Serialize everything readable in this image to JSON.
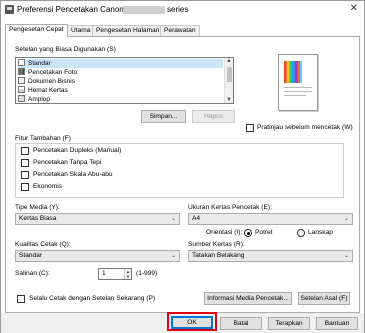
{
  "window": {
    "title_prefix": "Preferensi Pencetakan Canon",
    "title_suffix": "series",
    "close_glyph": "✕"
  },
  "tabs": [
    {
      "label": "Pengesetan Cepat",
      "active": true
    },
    {
      "label": "Utama"
    },
    {
      "label": "Pengesetan Halaman"
    },
    {
      "label": "Perawatan"
    }
  ],
  "common_settings": {
    "label": "Setelan yang Biasa Digunakan (S)",
    "items": [
      {
        "label": "Standar",
        "icon": "standard-icon"
      },
      {
        "label": "Pencetakan Foto",
        "icon": "photo-icon"
      },
      {
        "label": "Dokumen Bisnis",
        "icon": "document-icon"
      },
      {
        "label": "Hemat Kertas",
        "icon": "paper-saving-icon"
      },
      {
        "label": "Amplop",
        "icon": "envelope-icon"
      }
    ],
    "save_button": "Simpan...",
    "delete_button": "Hapus"
  },
  "preview_checkbox": "Pratinjau sebelum mencetak (W)",
  "additional_features": {
    "label": "Fitur Tambahan (F)",
    "items": [
      "Pencetakan Dupleks (Manual)",
      "Pencetakan Tanpa Tepi",
      "Pencetakan Skala Abu-abu",
      "Ekonomis"
    ]
  },
  "media_type": {
    "label": "Tipe Media (Y):",
    "value": "Kertas Biasa"
  },
  "paper_size": {
    "label": "Ukuran Kertas Pencetak (E):",
    "value": "A4"
  },
  "orientation": {
    "label": "Orientasi (I):",
    "portrait": "Potret",
    "landscape": "Lanskap"
  },
  "print_quality": {
    "label": "Kualitas Cetak (Q):",
    "value": "Standar"
  },
  "paper_source": {
    "label": "Sumber Kertas (R):",
    "value": "Tatakan Belakang"
  },
  "copies": {
    "label": "Salinan (C):",
    "value": "1",
    "range": "(1-999)"
  },
  "always_print_checkbox": "Selalu Cetak dengan Setelan Sekarang (P)",
  "media_info_button": "Informasi Media Pencetak...",
  "defaults_button": "Setelan Asal (F)",
  "footer": {
    "ok": "OK",
    "cancel": "Batal",
    "apply": "Terapkan",
    "help": "Bantuan"
  },
  "colors": {
    "highlight": "#e0001b",
    "selection": "#cce4f7"
  }
}
